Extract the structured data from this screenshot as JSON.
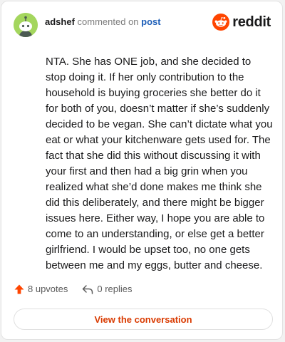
{
  "header": {
    "username": "adshef",
    "action_text": "commented on",
    "post_link": "post",
    "brand": "reddit"
  },
  "comment": {
    "body": "NTA. She has ONE job, and she decided to stop doing it. If her only contribution to the household is buying groceries she better do it for both of you, doesn’t matter if she’s suddenly decided to be vegan. She can’t dictate what you eat or what your kitchenware gets used for. The fact that she did this without discussing it with your first and then had a big grin when you realized what she’d done makes me think she did this deliberately, and there might be bigger issues here. Either way, I hope you are able to come to an understanding, or else get a better girlfriend. I would be upset too, no one gets between me and my eggs, butter and cheese."
  },
  "stats": {
    "upvotes": "8 upvotes",
    "replies": "0 replies"
  },
  "cta": {
    "label": "View the conversation"
  },
  "colors": {
    "brand": "#ff4500",
    "upvote": "#ff4500",
    "cta_text": "#d93a00",
    "link": "#1e5fb8",
    "avatar_bg": "#a4d65e"
  },
  "icons": {
    "avatar": "snoo-avatar-icon",
    "brand": "reddit-logo-icon",
    "upvote": "upvote-arrow-icon",
    "reply": "reply-arrow-icon"
  }
}
